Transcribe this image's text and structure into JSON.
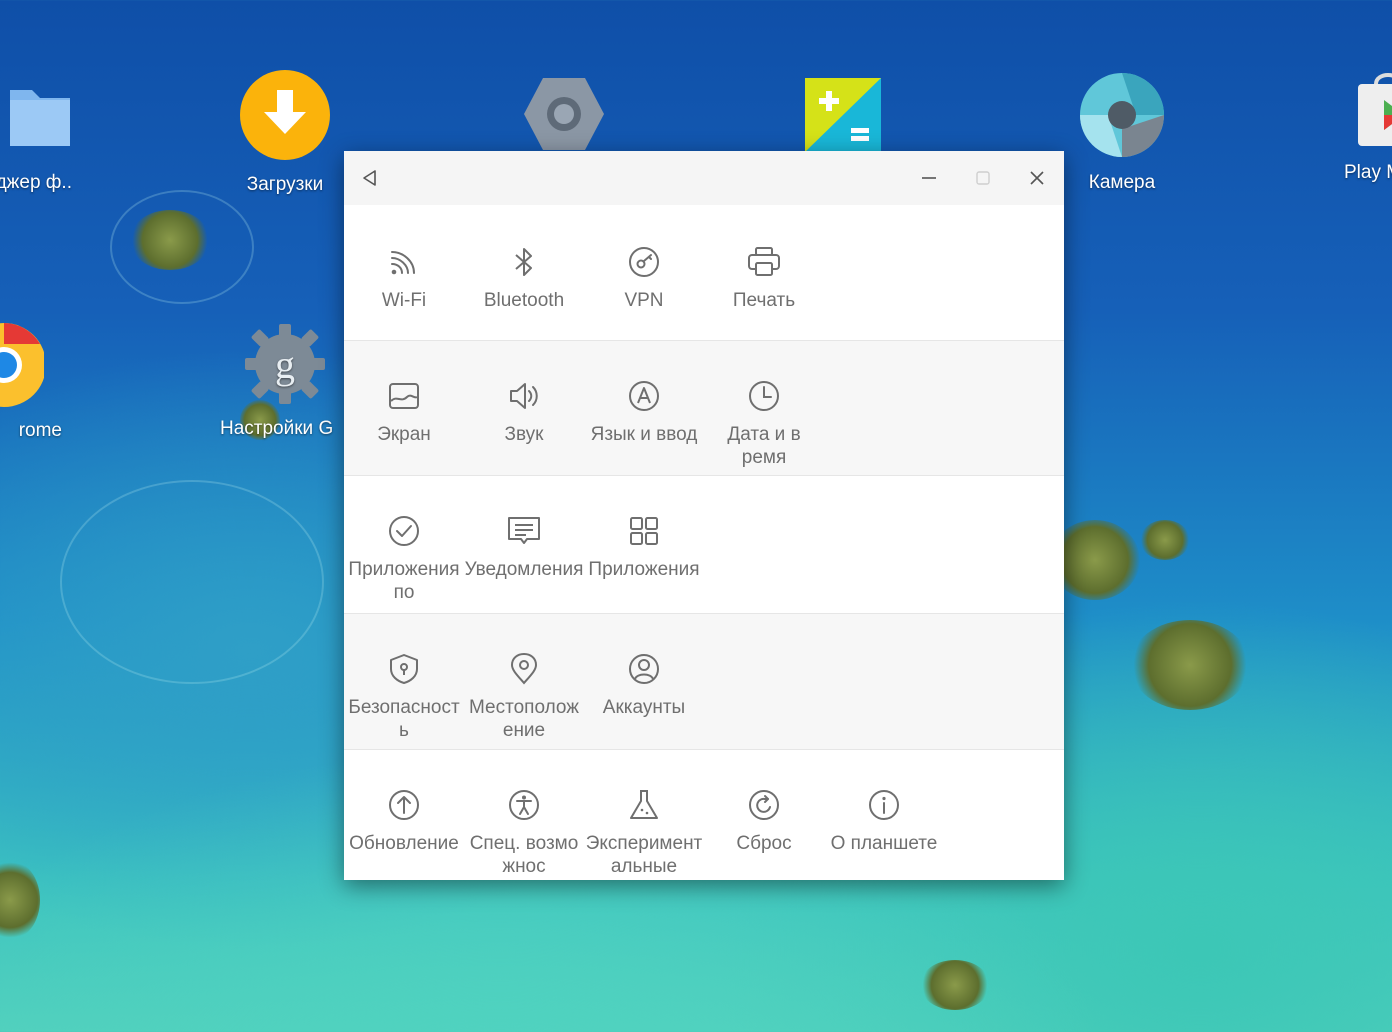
{
  "desktop": {
    "icons": [
      {
        "label": "джер ф.."
      },
      {
        "label": "Загрузки"
      },
      {
        "label": ""
      },
      {
        "label": ""
      },
      {
        "label": "Камера"
      },
      {
        "label": "Play M"
      },
      {
        "label": "rome"
      },
      {
        "label": "Настройки G"
      }
    ]
  },
  "window": {
    "titlebar": {
      "back_icon": "back-triangle-icon"
    },
    "sections": [
      {
        "items": [
          {
            "label": "Wi-Fi",
            "icon": "wifi-icon"
          },
          {
            "label": "Bluetooth",
            "icon": "bluetooth-icon"
          },
          {
            "label": "VPN",
            "icon": "vpn-icon"
          },
          {
            "label": "Печать",
            "icon": "printer-icon"
          }
        ]
      },
      {
        "items": [
          {
            "label": "Экран",
            "icon": "display-icon"
          },
          {
            "label": "Звук",
            "icon": "sound-icon"
          },
          {
            "label": "Язык и ввод",
            "icon": "language-icon"
          },
          {
            "label": "Дата и время",
            "icon": "clock-icon"
          }
        ]
      },
      {
        "items": [
          {
            "label": "Приложения по",
            "icon": "check-circle-icon"
          },
          {
            "label": "Уведомления",
            "icon": "notification-icon"
          },
          {
            "label": "Приложения",
            "icon": "apps-grid-icon"
          }
        ]
      },
      {
        "items": [
          {
            "label": "Безопасность",
            "icon": "shield-icon"
          },
          {
            "label": "Местоположение",
            "icon": "location-pin-icon"
          },
          {
            "label": "Аккаунты",
            "icon": "account-icon"
          }
        ]
      },
      {
        "items": [
          {
            "label": "Обновление",
            "icon": "update-icon"
          },
          {
            "label": "Спец. возможнос",
            "icon": "accessibility-icon"
          },
          {
            "label": "Экспериментальные",
            "icon": "flask-icon"
          },
          {
            "label": "Сброс",
            "icon": "reset-icon"
          },
          {
            "label": "О планшете",
            "icon": "info-icon"
          }
        ]
      }
    ]
  }
}
